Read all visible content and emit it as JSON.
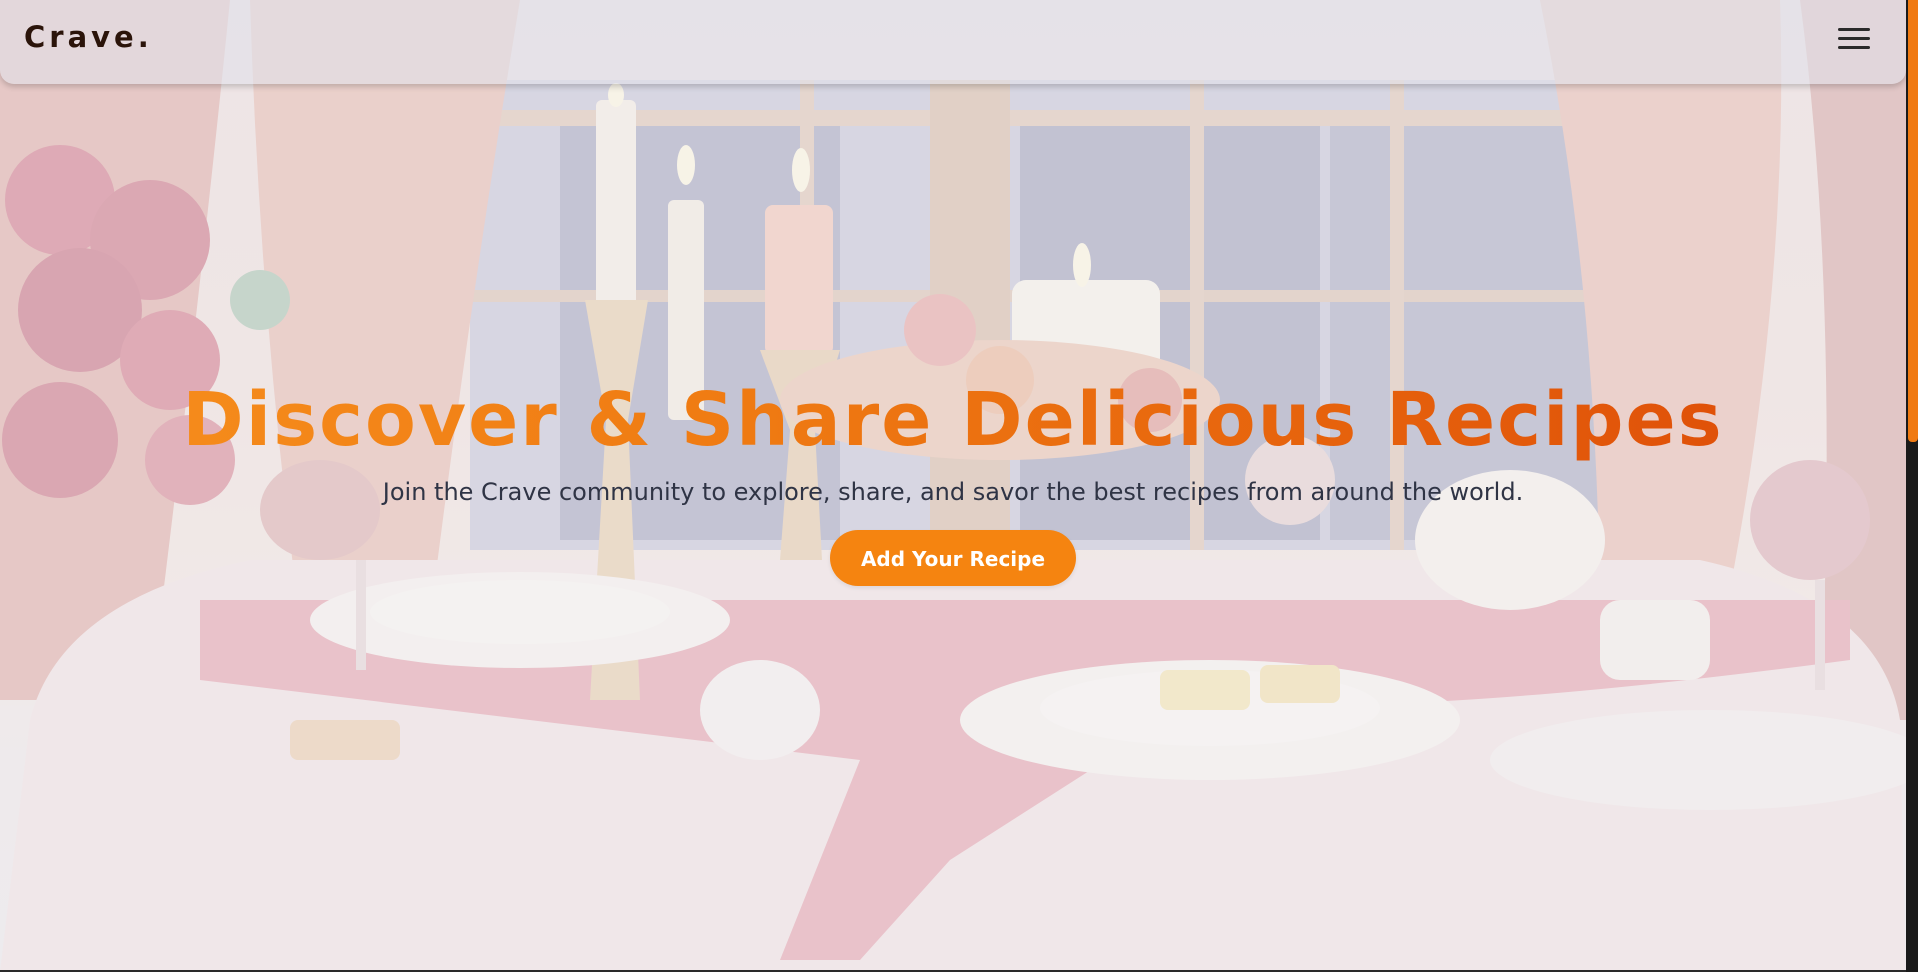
{
  "navbar": {
    "logo": "Crave.",
    "menu_icon": "hamburger-menu-icon"
  },
  "hero": {
    "title": "Discover & Share Delicious Recipes",
    "subtitle": "Join the Crave community to explore, share, and savor the best recipes from around the world.",
    "cta_label": "Add Your Recipe",
    "background_image": "candlelit dinner table by a window"
  },
  "colors": {
    "accent": "#f58410",
    "title_gradient_start": "#f7901e",
    "title_gradient_end": "#dd4a07",
    "logo": "#2b140a",
    "subtitle": "#2f3445"
  },
  "scrollbar": {
    "scroll_position": 0
  }
}
